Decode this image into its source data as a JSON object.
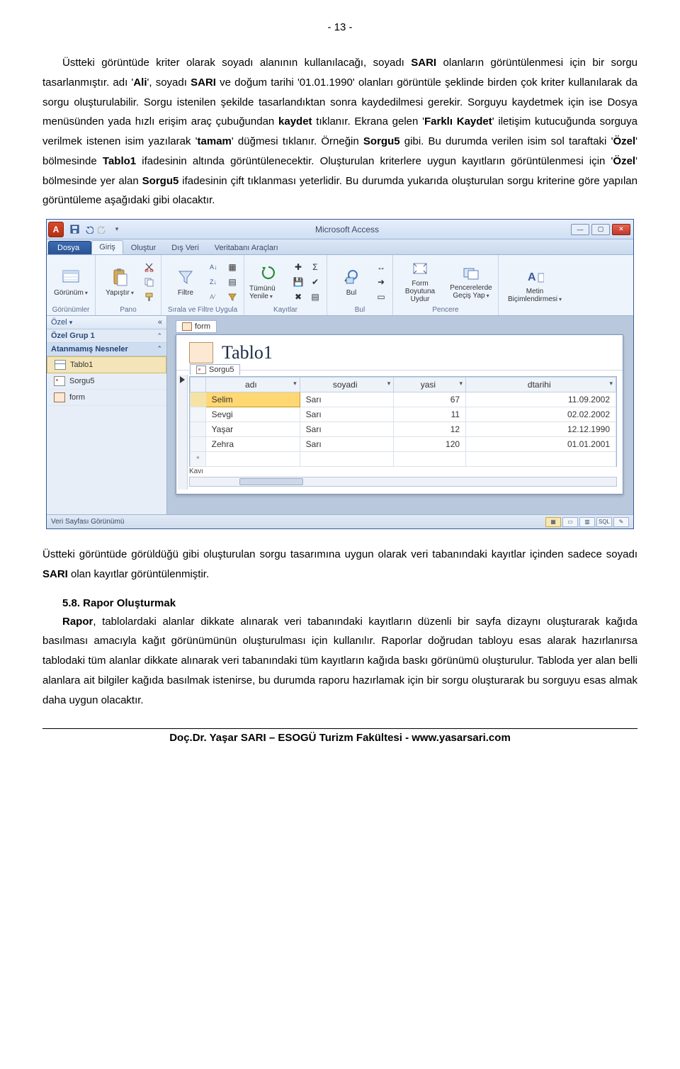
{
  "page_number_header": "- 13 -",
  "para1_html": "Üstteki görüntüde kriter olarak soyadı alanının kullanılacağı, soyadı <b>SARI</b> olanların görüntülenmesi için bir sorgu tasarlanmıştır. adı '<b>Ali</b>',   soyadı <b>SARI</b> ve doğum tarihi '01.01.1990' olanları görüntüle şeklinde birden çok kriter kullanılarak da sorgu oluşturulabilir. Sorgu istenilen şekilde tasarlandıktan sonra kaydedilmesi gerekir. Sorguyu kaydetmek için ise Dosya menüsünden yada hızlı erişim araç çubuğundan <b>kaydet</b> tıklanır. Ekrana gelen '<b>Farklı Kaydet</b>' iletişim kutucuğunda sorguya verilmek istenen isim yazılarak '<b>tamam</b>' düğmesi tıklanır. Örneğin <b>Sorgu5</b> gibi. Bu durumda verilen isim sol taraftaki '<b>Özel</b>' bölmesinde <b>Tablo1</b> ifadesinin altında görüntülenecektir. Oluşturulan kriterlere uygun kayıtların görüntülenmesi için '<b>Özel</b>' bölmesinde yer alan <b>Sorgu5</b> ifadesinin çift tıklanması yeterlidir. Bu durumda yukarıda oluşturulan sorgu kriterine göre yapılan görüntüleme aşağıdaki gibi olacaktır.",
  "para2_html": "Üstteki görüntüde görüldüğü gibi oluşturulan sorgu tasarımına uygun olarak veri tabanındaki kayıtlar içinden sadece soyadı <b>SARI</b> olan kayıtlar görüntülenmiştir.",
  "heading58": "5.8. Rapor Oluşturmak",
  "para3_html": "<b>Rapor</b>, tablolardaki alanlar dikkate alınarak veri tabanındaki kayıtların düzenli bir sayfa dizaynı oluşturarak kağıda basılması amacıyla kağıt görünümünün oluşturulması için kullanılır. Raporlar doğrudan tabloyu esas alarak hazırlanırsa tablodaki tüm alanlar dikkate alınarak veri tabanındaki tüm kayıtların kağıda baskı görünümü oluşturulur. Tabloda yer alan belli alanlara ait bilgiler kağıda basılmak istenirse, bu durumda raporu hazırlamak için bir sorgu oluşturarak bu sorguyu esas almak daha uygun olacaktır.",
  "footer": "Doç.Dr. Yaşar SARI – ESOGÜ Turizm Fakültesi - www.yasarsari.com",
  "access": {
    "app_letter": "A",
    "title": "Microsoft Access",
    "file_tab": "Dosya",
    "tabs": [
      "Giriş",
      "Oluştur",
      "Dış Veri",
      "Veritabanı Araçları"
    ],
    "groups": {
      "g1": {
        "btn": "Görünüm",
        "title": "Görünümler"
      },
      "g2": {
        "btn": "Yapıştır",
        "title": "Pano"
      },
      "g3": {
        "btn": "Filtre",
        "title": "Sırala ve Filtre Uygula"
      },
      "g4": {
        "btn": "Tümünü Yenile",
        "title": "Kayıtlar"
      },
      "g5": {
        "btn": "Bul",
        "title": "Bul"
      },
      "g6": {
        "btn1": "Form Boyutuna Uydur",
        "btn2": "Pencerelerde Geçiş Yap",
        "title": "Pencere"
      },
      "g7": {
        "btn": "Metin Biçimlendirmesi",
        "title": ""
      }
    },
    "nav": {
      "header": "Özel",
      "group": "Özel Grup 1",
      "section": "Atanmamış Nesneler",
      "items": [
        {
          "label": "Tablo1",
          "type": "table"
        },
        {
          "label": "Sorgu5",
          "type": "query"
        },
        {
          "label": "form",
          "type": "form"
        }
      ]
    },
    "doc_tab": "form",
    "form_title": "Tablo1",
    "sub_tab": "Sorgu5",
    "columns": [
      "adı",
      "soyadi",
      "yasi",
      "dtarihi"
    ],
    "rows": [
      {
        "adi": "Selim",
        "soyadi": "Sarı",
        "yasi": "67",
        "dtarihi": "11.09.2002",
        "selected": true
      },
      {
        "adi": "Sevgi",
        "soyadi": "Sarı",
        "yasi": "11",
        "dtarihi": "02.02.2002"
      },
      {
        "adi": "Yaşar",
        "soyadi": "Sarı",
        "yasi": "12",
        "dtarihi": "12.12.1990"
      },
      {
        "adi": "Zehra",
        "soyadi": "Sarı",
        "yasi": "120",
        "dtarihi": "01.01.2001"
      }
    ],
    "new_row_marker": "*",
    "nav_record_label": "Kavı",
    "status_text": "Veri Sayfası Görünümü",
    "view_sql": "SQL"
  }
}
